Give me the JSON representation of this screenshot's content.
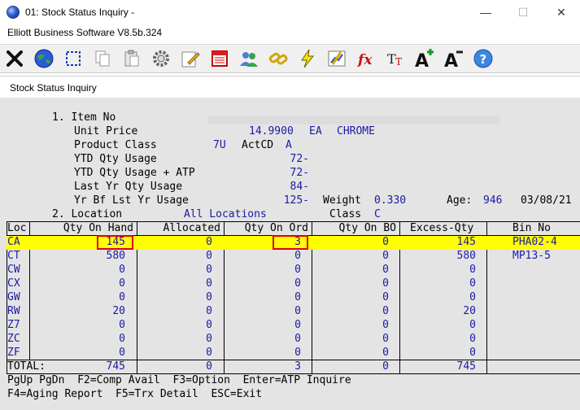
{
  "window": {
    "title": "01: Stock Status Inquiry -",
    "min_glyph": "—",
    "max_glyph": "☐",
    "close_glyph": "✕"
  },
  "app": {
    "version": "Elliott Business Software V8.5b.324"
  },
  "toolbar": {
    "icons": [
      "close-icon",
      "globe-icon",
      "select-icon",
      "copy-icon",
      "paste-icon",
      "gear-icon",
      "edit-icon",
      "calculator-icon",
      "users-icon",
      "link-icon",
      "lightning-icon",
      "chart-icon",
      "function-icon",
      "font-size-icon",
      "font-increase-icon",
      "font-decrease-icon",
      "help-icon"
    ]
  },
  "panel": {
    "title": "Stock Status Inquiry"
  },
  "header": {
    "item_no_label": "1. Item No",
    "unit_price_label": "Unit Price",
    "unit_price_value": "14.9900",
    "unit_price_uom": "EA",
    "unit_price_desc": "CHROME",
    "product_class_label": "Product Class",
    "product_class_value": "7U",
    "actcd_label": "ActCD",
    "actcd_value": "A",
    "ytd_qty_usage_label": "YTD Qty Usage",
    "ytd_qty_usage_value": "72-",
    "ytd_qty_usage_atp_label": "YTD Qty Usage + ATP",
    "ytd_qty_usage_atp_value": "72-",
    "last_yr_qty_usage_label": "Last Yr Qty Usage",
    "last_yr_qty_usage_value": "84-",
    "yr_bf_lst_yr_usage_label": "Yr Bf Lst Yr Usage",
    "yr_bf_lst_yr_usage_value": "125-",
    "weight_label": "Weight",
    "weight_value": "0.330",
    "age_label": "Age:",
    "age_value": "946",
    "date_value": "03/08/21",
    "location_label": "2. Location",
    "location_value": "All Locations",
    "class_label": "Class",
    "class_value": "C"
  },
  "table": {
    "columns": [
      "Loc",
      "Qty On Hand",
      "Allocated",
      "Qty On Ord",
      "Qty On BO",
      "Excess-Qty",
      "Bin No"
    ],
    "rows": [
      {
        "loc": "CA",
        "on_hand": "145",
        "allocated": "0",
        "on_ord": "3",
        "on_bo": "0",
        "excess": "145",
        "bin": "PHA02-4"
      },
      {
        "loc": "CT",
        "on_hand": "580",
        "allocated": "0",
        "on_ord": "0",
        "on_bo": "0",
        "excess": "580",
        "bin": "MP13-5"
      },
      {
        "loc": "CW",
        "on_hand": "0",
        "allocated": "0",
        "on_ord": "0",
        "on_bo": "0",
        "excess": "0",
        "bin": ""
      },
      {
        "loc": "CX",
        "on_hand": "0",
        "allocated": "0",
        "on_ord": "0",
        "on_bo": "0",
        "excess": "0",
        "bin": ""
      },
      {
        "loc": "GW",
        "on_hand": "0",
        "allocated": "0",
        "on_ord": "0",
        "on_bo": "0",
        "excess": "0",
        "bin": ""
      },
      {
        "loc": "RW",
        "on_hand": "20",
        "allocated": "0",
        "on_ord": "0",
        "on_bo": "0",
        "excess": "20",
        "bin": ""
      },
      {
        "loc": "Z7",
        "on_hand": "0",
        "allocated": "0",
        "on_ord": "0",
        "on_bo": "0",
        "excess": "0",
        "bin": ""
      },
      {
        "loc": "ZC",
        "on_hand": "0",
        "allocated": "0",
        "on_ord": "0",
        "on_bo": "0",
        "excess": "0",
        "bin": ""
      },
      {
        "loc": "ZF",
        "on_hand": "0",
        "allocated": "0",
        "on_ord": "0",
        "on_bo": "0",
        "excess": "0",
        "bin": ""
      }
    ],
    "total": {
      "label": "TOTAL:",
      "on_hand": "745",
      "allocated": "0",
      "on_ord": "3",
      "on_bo": "0",
      "excess": "745"
    },
    "highlight_color": "#ffff00",
    "box_color": "#e00000"
  },
  "footer": {
    "line1": "PgUp PgDn  F2=Comp Avail  F3=Option  Enter=ATP Inquire",
    "line2": "F4=Aging Report  F5=Trx Detail  ESC=Exit"
  }
}
